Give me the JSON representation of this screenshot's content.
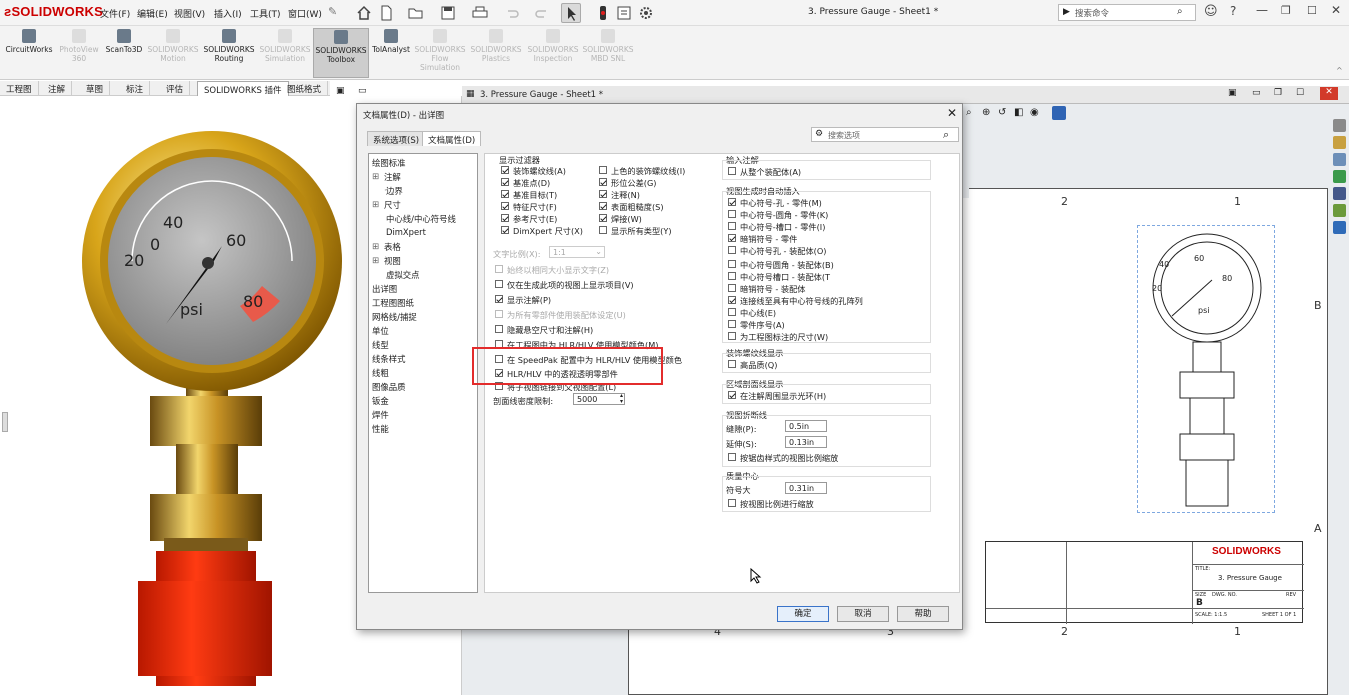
{
  "app": {
    "brand": "SOLIDWORKS"
  },
  "menu": [
    "文件(F)",
    "编辑(E)",
    "视图(V)",
    "插入(I)",
    "工具(T)",
    "窗口(W)"
  ],
  "title": "3. Pressure Gauge - Sheet1 *",
  "search": {
    "placeholder": "搜索命令"
  },
  "command_bar": [
    {
      "label": "CircuitWorks",
      "enabled": true
    },
    {
      "label": "PhotoView 360",
      "enabled": false
    },
    {
      "label": "ScanTo3D",
      "enabled": true
    },
    {
      "label": "SOLIDWORKS Motion",
      "enabled": false
    },
    {
      "label": "SOLIDWORKS Routing",
      "enabled": true
    },
    {
      "label": "SOLIDWORKS Simulation",
      "enabled": false
    },
    {
      "label": "SOLIDWORKS Toolbox",
      "enabled": true
    },
    {
      "label": "TolAnalyst",
      "enabled": true
    },
    {
      "label": "SOLIDWORKS Flow Simulation",
      "enabled": false
    },
    {
      "label": "SOLIDWORKS Plastics",
      "enabled": false
    },
    {
      "label": "SOLIDWORKS Inspection",
      "enabled": false
    },
    {
      "label": "SOLIDWORKS MBD SNL",
      "enabled": false
    }
  ],
  "tabs": [
    "工程图",
    "注解",
    "草图",
    "标注",
    "评估",
    "SOLIDWORKS 插件",
    "图纸格式"
  ],
  "drawing": {
    "window_title": "3. Pressure Gauge - Sheet1 *",
    "zones_top": [
      "2",
      "1"
    ],
    "zones_bottom": [
      "4",
      "3",
      "2",
      "1"
    ],
    "zones_right": [
      "B",
      "A"
    ],
    "gauge_labels": [
      "0",
      "20",
      "40",
      "60",
      "80",
      "psi"
    ],
    "title_block": {
      "brand": "SOLIDWORKS",
      "title_label": "TITLE:",
      "title": "3. Pressure Gauge",
      "size_label": "SIZE",
      "dwg_label": "DWG.  NO.",
      "rev_label": "REV",
      "size": "B",
      "scale": "SCALE: 1:1.5",
      "sheet": "SHEET 1 OF 1"
    }
  },
  "dialog": {
    "title": "文档属性(D) - 出详图",
    "tabs": [
      "系统选项(S)",
      "文档属性(D)"
    ],
    "search_placeholder": "搜索选项",
    "tree": [
      {
        "label": "绘图标准",
        "indent": 0
      },
      {
        "label": "注解",
        "indent": 1,
        "expand": true
      },
      {
        "label": "边界",
        "indent": 2
      },
      {
        "label": "尺寸",
        "indent": 1,
        "expand": true
      },
      {
        "label": "中心线/中心符号线",
        "indent": 2
      },
      {
        "label": "DimXpert",
        "indent": 2
      },
      {
        "label": "表格",
        "indent": 1,
        "expand": true
      },
      {
        "label": "视图",
        "indent": 1,
        "expand": true
      },
      {
        "label": "虚拟交点",
        "indent": 2
      },
      {
        "label": "出详图",
        "indent": 0
      },
      {
        "label": "工程图图纸",
        "indent": 0
      },
      {
        "label": "网格线/捕捉",
        "indent": 0
      },
      {
        "label": "单位",
        "indent": 0
      },
      {
        "label": "线型",
        "indent": 0
      },
      {
        "label": "线条样式",
        "indent": 0
      },
      {
        "label": "线粗",
        "indent": 0
      },
      {
        "label": "图像品质",
        "indent": 0
      },
      {
        "label": "钣金",
        "indent": 0
      },
      {
        "label": "焊件",
        "indent": 0
      },
      {
        "label": "性能",
        "indent": 0
      }
    ],
    "filter": {
      "title": "显示过滤器",
      "left": [
        {
          "label": "装饰螺纹线(A)",
          "checked": true
        },
        {
          "label": "基准点(D)",
          "checked": true
        },
        {
          "label": "基准目标(T)",
          "checked": true
        },
        {
          "label": "特征尺寸(F)",
          "checked": true
        },
        {
          "label": "参考尺寸(E)",
          "checked": true
        },
        {
          "label": "DimXpert 尺寸(X)",
          "checked": true
        }
      ],
      "right": [
        {
          "label": "上色的装饰螺纹线(I)",
          "checked": false
        },
        {
          "label": "形位公差(G)",
          "checked": true
        },
        {
          "label": "注释(N)",
          "checked": true
        },
        {
          "label": "表面粗糙度(S)",
          "checked": true
        },
        {
          "label": "焊接(W)",
          "checked": true
        },
        {
          "label": "显示所有类型(Y)",
          "checked": false
        }
      ]
    },
    "text_scale_label": "文字比例(X):",
    "text_scale_value": "1:1",
    "options": [
      {
        "label": "始终以相同大小显示文字(Z)",
        "checked": false,
        "disabled": true
      },
      {
        "label": "仅在生成此项的视图上显示项目(V)",
        "checked": false
      },
      {
        "label": "显示注解(P)",
        "checked": true
      },
      {
        "label": "为所有零部件使用装配体设定(U)",
        "checked": false,
        "disabled": true
      },
      {
        "label": "隐藏悬空尺寸和注解(H)",
        "checked": false
      },
      {
        "label": "在工程图中为 HLR/HLV 使用模型颜色(M)",
        "checked": false
      },
      {
        "label": "在 SpeedPak 配置中为 HLR/HLV 使用模型颜色",
        "checked": false
      },
      {
        "label": "HLR/HLV 中的透视透明零部件",
        "checked": true
      },
      {
        "label": "将子视图链接到父视图配置(L)",
        "checked": false
      }
    ],
    "hatch_label": "剖面线密度限制:",
    "hatch_value": "5000",
    "insert_anno": {
      "title": "输入注解",
      "items": [
        {
          "label": "从整个装配体(A)",
          "checked": false
        }
      ]
    },
    "auto_insert": {
      "title": "视图生成时自动插入",
      "items": [
        {
          "label": "中心符号-孔 - 零件(M)",
          "checked": true
        },
        {
          "label": "中心符号-圆角 - 零件(K)",
          "checked": false
        },
        {
          "label": "中心符号-槽口 - 零件(I)",
          "checked": false
        },
        {
          "label": "暗销符号 - 零件",
          "checked": true
        },
        {
          "label": "中心符号孔 - 装配体(O)",
          "checked": false
        },
        {
          "label": "中心符号圆角 - 装配体(B)",
          "checked": false
        },
        {
          "label": "中心符号槽口 - 装配体(T",
          "checked": false
        },
        {
          "label": "暗销符号 - 装配体",
          "checked": false
        },
        {
          "label": "连接线至具有中心符号线的孔阵列",
          "checked": true
        },
        {
          "label": "中心线(E)",
          "checked": false
        },
        {
          "label": "零件序号(A)",
          "checked": false
        },
        {
          "label": "为工程图标注的尺寸(W)",
          "checked": false
        }
      ]
    },
    "thread": {
      "title": "装饰螺纹线显示",
      "items": [
        {
          "label": "高品质(Q)",
          "checked": false
        }
      ]
    },
    "area_hatch": {
      "title": "区域剖面线显示",
      "items": [
        {
          "label": "在注解周围显示光环(H)",
          "checked": true
        }
      ]
    },
    "break_line": {
      "title": "视图折断线",
      "gap_label": "缝隙(P):",
      "gap": "0.5in",
      "ext_label": "延伸(S):",
      "ext": "0.13in",
      "scale_label": "按锯齿样式的视图比例缩放",
      "scale_checked": false
    },
    "mass_center": {
      "title": "质量中心",
      "size_label": "符号大",
      "size": "0.31in",
      "scale_label": "按视图比例进行缩放",
      "scale_checked": false
    },
    "buttons": {
      "ok": "确定",
      "cancel": "取消",
      "help": "帮助"
    }
  }
}
